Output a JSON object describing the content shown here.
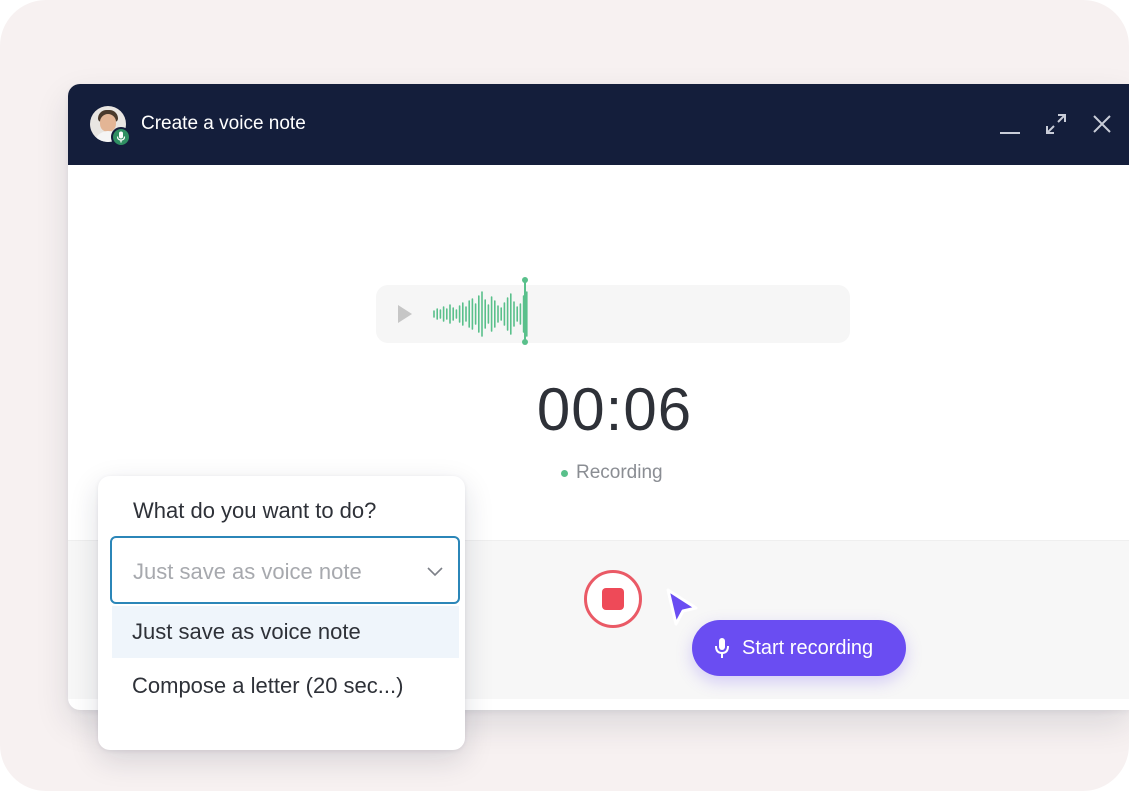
{
  "window": {
    "title": "Create a voice note"
  },
  "player": {
    "timer": "00:06",
    "status": "Recording"
  },
  "controls": {
    "start_label": "Start recording"
  },
  "dropdown": {
    "question": "What do you want to do?",
    "selected_value": "Just save as voice note",
    "options": [
      {
        "label": "Just save as voice note"
      },
      {
        "label": "Compose a letter (20 sec...)"
      }
    ]
  },
  "colors": {
    "titlebar": "#141e3b",
    "accent": "#6a4df2",
    "recording": "#59c08b",
    "stop": "#ee4a58",
    "select_border": "#2b86b8"
  },
  "icons": [
    "mic-icon",
    "minimize-icon",
    "expand-icon",
    "close-icon",
    "play-icon",
    "stop-icon",
    "chevron-down-icon",
    "cursor-icon"
  ]
}
